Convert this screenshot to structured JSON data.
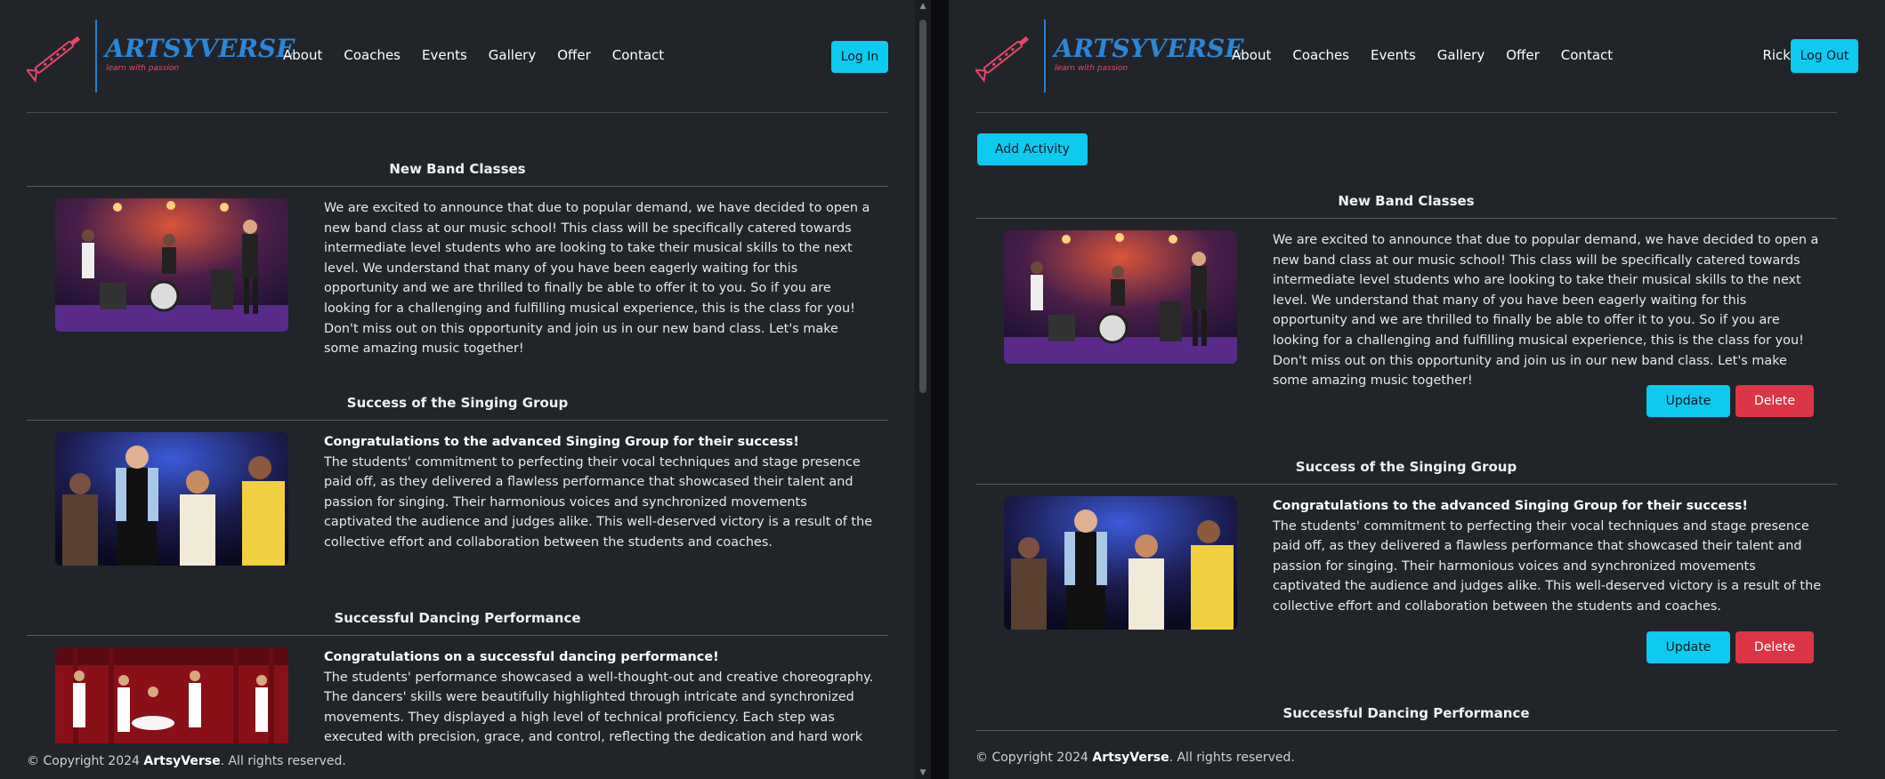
{
  "nav": {
    "brand": "ARTSYVERSE",
    "tagline": "learn with passion",
    "links": [
      "About",
      "Coaches",
      "Events",
      "Gallery",
      "Offer",
      "Contact"
    ],
    "login_label": "Log In",
    "user_name": "Rick",
    "logout_label": "Log Out"
  },
  "admin": {
    "add_activity_label": "Add Activity",
    "update_label": "Update",
    "delete_label": "Delete"
  },
  "posts": [
    {
      "title": "New Band Classes",
      "headline": "",
      "body": "We are excited to announce that due to popular demand, we have decided to open a new band class at our music school! This class will be specifically catered towards intermediate level students who are looking to take their musical skills to the next level. We understand that many of you have been eagerly waiting for this opportunity and we are thrilled to finally be able to offer it to you. So if you are looking for a challenging and fulfilling musical experience, this is the class for you! Don't miss out on this opportunity and join us in our new band class. Let's make some amazing music together!"
    },
    {
      "title": "Success of the Singing Group",
      "headline": "Congratulations to the advanced Singing Group for their success!",
      "body": "The students' commitment to perfecting their vocal techniques and stage presence paid off, as they delivered a flawless performance that showcased their talent and passion for singing. Their harmonious voices and synchronized movements captivated the audience and judges alike. This well-deserved victory is a result of the collective effort and collaboration between the students and coaches."
    },
    {
      "title": "Successful Dancing Performance",
      "headline": "Congratulations on a successful dancing performance!",
      "body": "The students' performance showcased a well-thought-out and creative choreography. The dancers' skills were beautifully highlighted through intricate and synchronized movements. They displayed a high level of technical proficiency. Each step was executed with precision, grace, and control, reflecting the dedication and hard work put into training. This performance is a"
    }
  ],
  "footer": {
    "prefix": "© Copyright 2024",
    "brand": "ArtsyVerse",
    "suffix": ". All rights reserved."
  },
  "colors": {
    "accent": "#0dcaf0",
    "danger": "#dc3545",
    "brand": "#2b86d6",
    "background": "#212429"
  }
}
